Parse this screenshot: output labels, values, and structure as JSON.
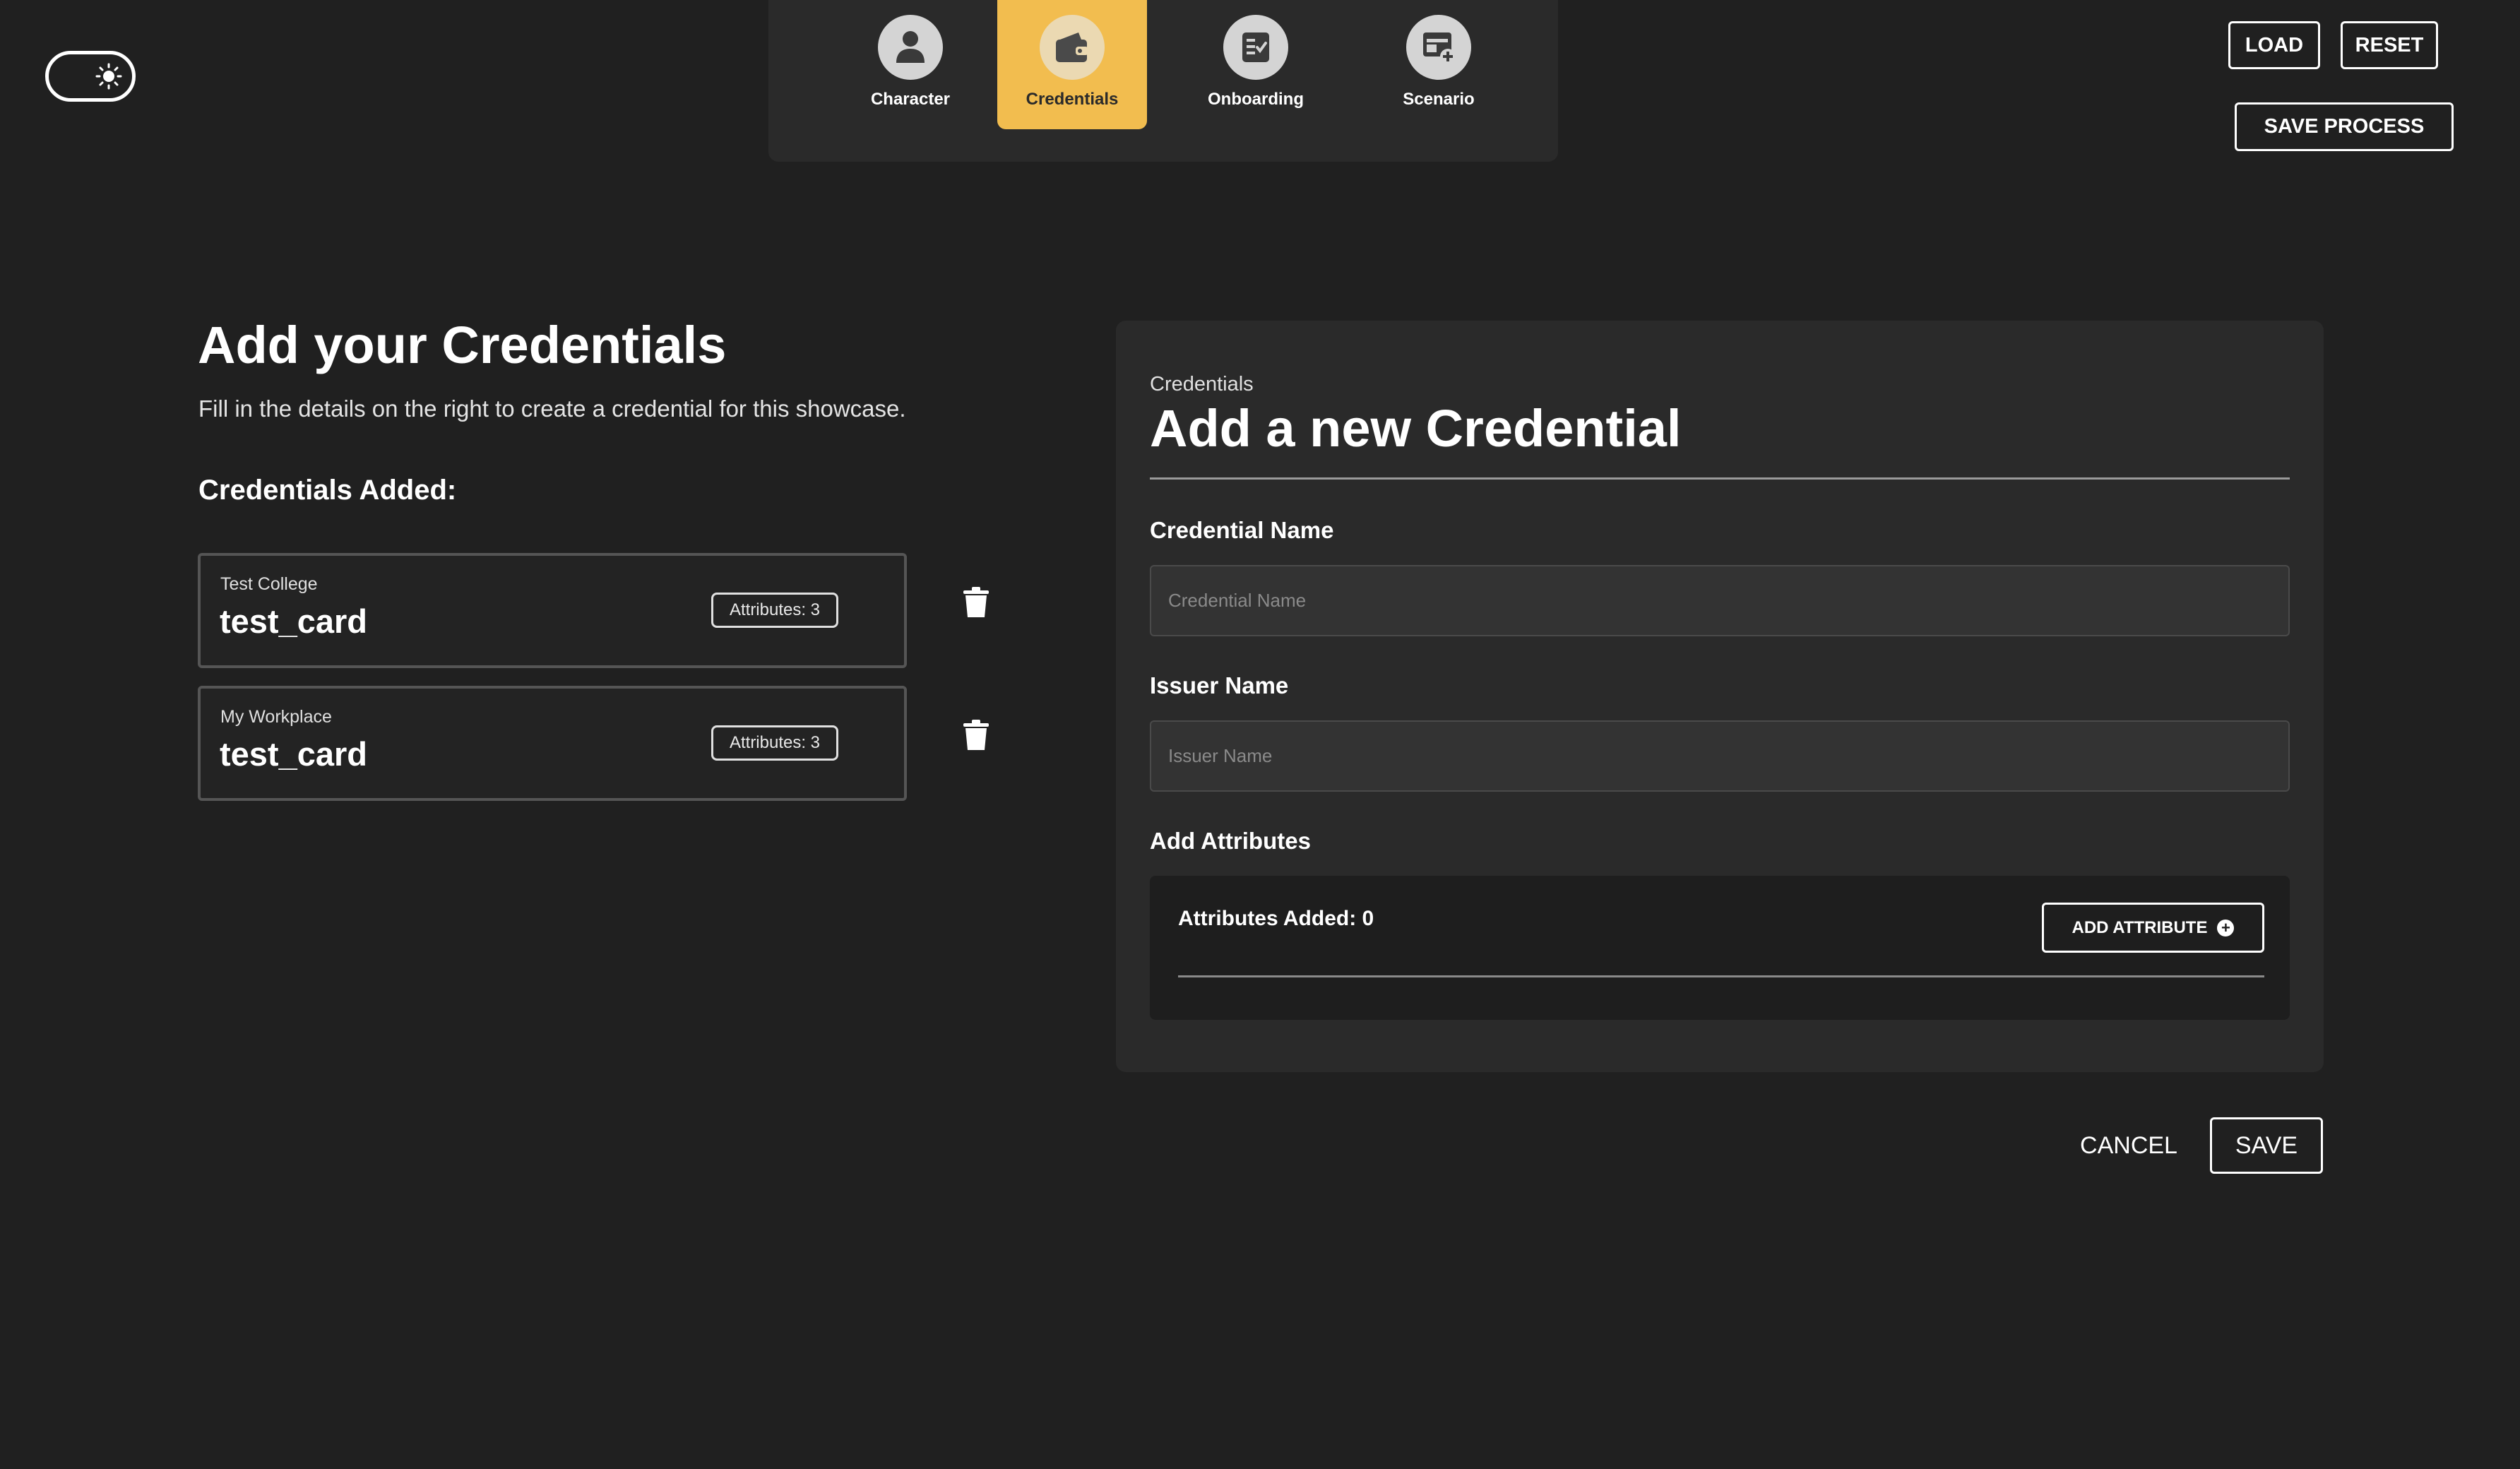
{
  "theme_toggle": {
    "icon": "sun-icon"
  },
  "nav": {
    "items": [
      {
        "label": "Character",
        "icon": "person-icon",
        "active": false
      },
      {
        "label": "Credentials",
        "icon": "wallet-icon",
        "active": true
      },
      {
        "label": "Onboarding",
        "icon": "checklist-icon",
        "active": false
      },
      {
        "label": "Scenario",
        "icon": "window-plus-icon",
        "active": false
      }
    ]
  },
  "toolbar": {
    "load_label": "LOAD",
    "reset_label": "RESET",
    "save_process_label": "SAVE PROCESS"
  },
  "main": {
    "title": "Add your Credentials",
    "description": "Fill in the details on the right to create a credential for this showcase.",
    "added_heading": "Credentials Added:",
    "credentials": [
      {
        "issuer": "Test College",
        "name": "test_card",
        "attributes_label": "Attributes: 3"
      },
      {
        "issuer": "My Workplace",
        "name": "test_card",
        "attributes_label": "Attributes: 3"
      }
    ]
  },
  "form": {
    "eyebrow": "Credentials",
    "title": "Add a new Credential",
    "credential_name": {
      "label": "Credential Name",
      "placeholder": "Credential Name",
      "value": ""
    },
    "issuer_name": {
      "label": "Issuer Name",
      "placeholder": "Issuer Name",
      "value": ""
    },
    "attributes": {
      "label": "Add Attributes",
      "count_label": "Attributes Added: 0",
      "add_button_label": "ADD ATTRIBUTE"
    }
  },
  "actions": {
    "cancel_label": "CANCEL",
    "save_label": "SAVE"
  },
  "colors": {
    "background": "#202020",
    "panel": "#2a2a2a",
    "accent": "#f2bd4f"
  }
}
